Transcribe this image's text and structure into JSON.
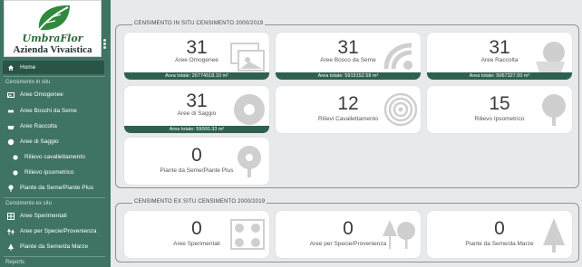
{
  "brand": {
    "name": "UmbraFlor",
    "subtitle": "Azienda Vivaistica"
  },
  "sidebar": {
    "home": "Home",
    "section_in_situ": "Censimento in situ",
    "in_situ_items": [
      "Aree Omogenee",
      "Aree Boschi da Seme",
      "Aree Raccolta",
      "Aree di Saggio",
      "Rilievo cavallettamento",
      "Rilievo ipsometrico",
      "Piante da Seme/Piante Plus"
    ],
    "section_ex_situ": "Censimento ex situ",
    "ex_situ_items": [
      "Aree Sperimentali",
      "Aree per Specie/Provenienza",
      "Piante da Seme/da Marze"
    ],
    "section_reports": "Reports"
  },
  "in_situ": {
    "title": "CENSIMENTO IN SITU CENSIMENTO 2000/2019",
    "cards": [
      {
        "value": "31",
        "label": "Aree Omogenee",
        "footer": "Area totale: 26774518.10 m²",
        "icon": "map-photos-icon"
      },
      {
        "value": "31",
        "label": "Aree Bosco da Seme",
        "footer": "Area totale: 5919152.58 m²",
        "icon": "seeds-icon"
      },
      {
        "value": "31",
        "label": "Aree Raccolta",
        "footer": "Area totale: 5067327.00 m²",
        "icon": "basket-icon"
      },
      {
        "value": "31",
        "label": "Aree di Saggio",
        "footer": "Area totale: 59000.33 m²",
        "icon": "sample-disc-icon"
      },
      {
        "value": "12",
        "label": "Rilievi Cavallettamento",
        "footer": "",
        "icon": "tree-rings-icon"
      },
      {
        "value": "15",
        "label": "Rilievo Ipsometrico",
        "footer": "",
        "icon": "tree-height-icon"
      },
      {
        "value": "0",
        "label": "Piante da Seme/Piante Plus",
        "footer": "",
        "icon": "tree-marker-icon"
      }
    ]
  },
  "ex_situ": {
    "title": "CENSIMENTO EX SITU CENSIMENTO 2000/2019",
    "cards": [
      {
        "value": "0",
        "label": "Aree Sperimentali",
        "icon": "tree-grid-icon"
      },
      {
        "value": "0",
        "label": "Aree per Specie/Provenienza",
        "icon": "trees-icon"
      },
      {
        "value": "0",
        "label": "Piante da Seme/da Marze",
        "icon": "pine-icon"
      }
    ]
  },
  "colors": {
    "sidebar": "#3f7464",
    "active": "#2a5446",
    "card_footer": "#2f5f50",
    "background": "#e7e9ea"
  }
}
